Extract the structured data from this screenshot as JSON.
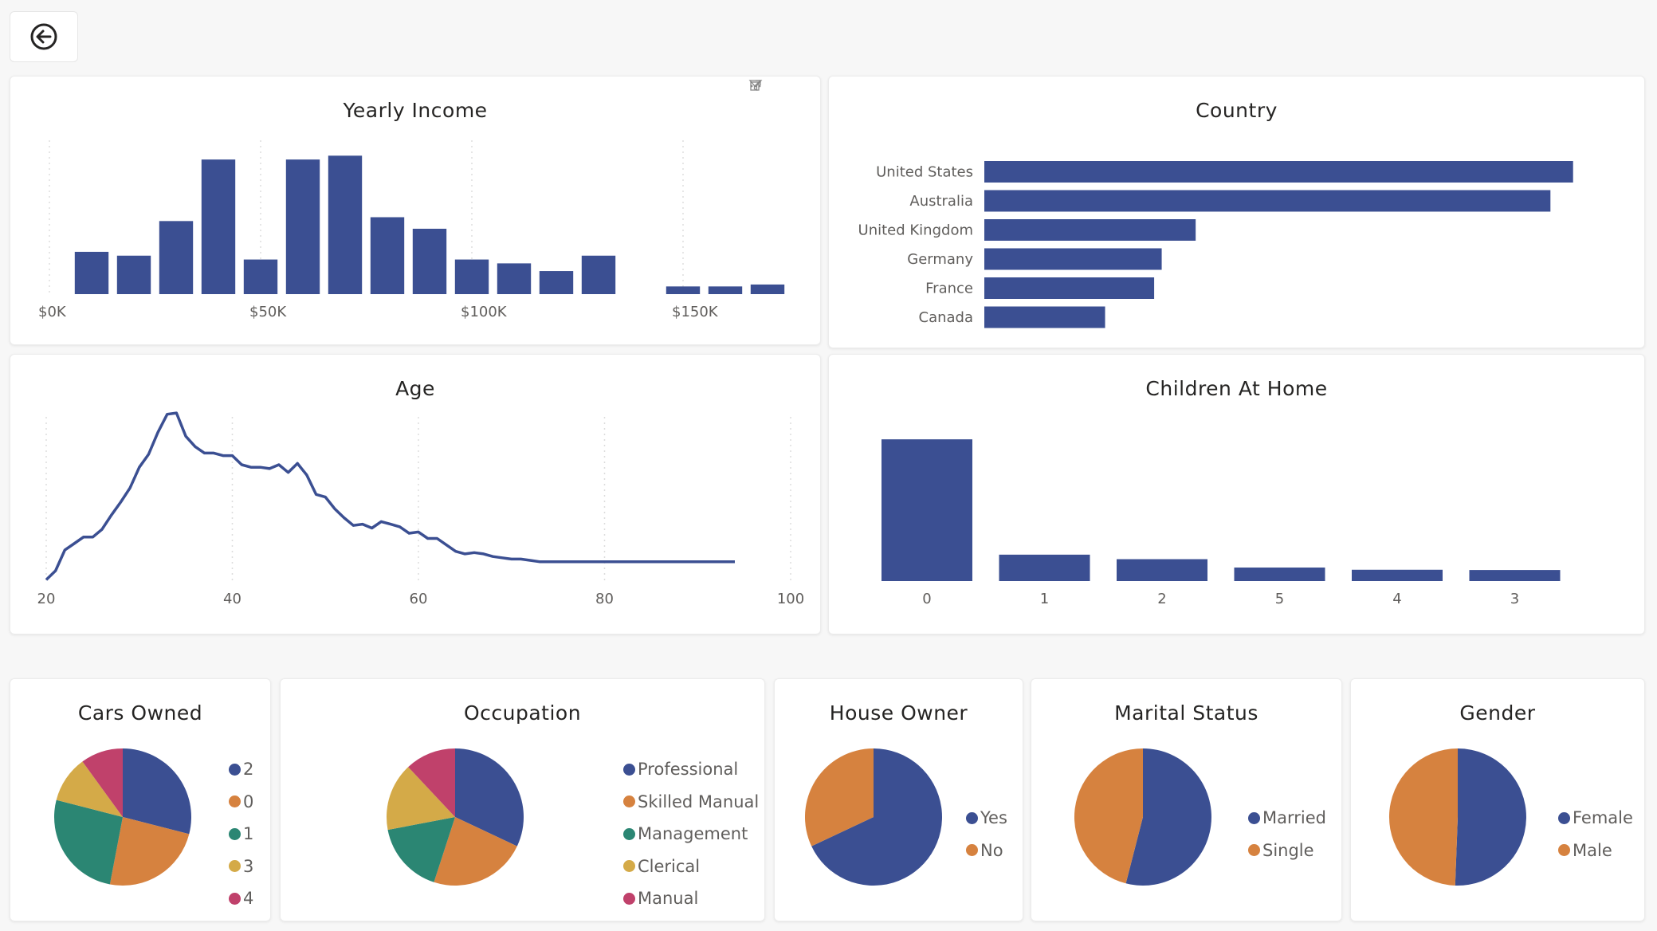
{
  "colors": {
    "blue": "#3b4f92",
    "orange": "#d6823f",
    "teal": "#2b8673",
    "yellow": "#d4aa48",
    "magenta": "#c0416b",
    "grid": "#dddddd"
  },
  "back_icon": "back-arrow-icon",
  "toolbar_icons": [
    "filter-icon",
    "focus-mode-icon",
    "more-options-icon"
  ],
  "income": {
    "title": "Yearly Income",
    "chart_data": {
      "type": "bar",
      "title": "Yearly Income",
      "x": [
        10000,
        20000,
        30000,
        40000,
        50000,
        60000,
        70000,
        80000,
        90000,
        100000,
        110000,
        120000,
        130000,
        150000,
        160000,
        170000
      ],
      "values": [
        1100,
        1000,
        1900,
        3500,
        900,
        3500,
        3600,
        2000,
        1700,
        900,
        800,
        600,
        1000,
        200,
        200,
        250
      ],
      "xlim": [
        0,
        180000
      ],
      "x_ticks": [
        0,
        50000,
        100000,
        150000
      ],
      "x_tick_labels": [
        "$0K",
        "$50K",
        "$100K",
        "$150K"
      ],
      "ylim": [
        0,
        4000
      ],
      "grid": "vertical-dotted"
    }
  },
  "country": {
    "title": "Country",
    "chart_data": {
      "type": "bar",
      "orientation": "horizontal",
      "title": "Country",
      "categories": [
        "United States",
        "Australia",
        "United Kingdom",
        "Germany",
        "France",
        "Canada"
      ],
      "values": [
        7800,
        7500,
        2800,
        2350,
        2250,
        1600
      ],
      "xlim": [
        0,
        8500
      ]
    }
  },
  "age": {
    "title": "Age",
    "chart_data": {
      "type": "line",
      "title": "Age",
      "x": [
        20,
        21,
        22,
        23,
        24,
        25,
        26,
        27,
        28,
        29,
        30,
        31,
        32,
        33,
        34,
        35,
        36,
        37,
        38,
        39,
        40,
        41,
        42,
        43,
        44,
        45,
        46,
        47,
        48,
        49,
        50,
        51,
        52,
        53,
        54,
        55,
        56,
        57,
        58,
        59,
        60,
        61,
        62,
        63,
        64,
        65,
        66,
        67,
        68,
        69,
        70,
        71,
        72,
        73,
        74,
        75,
        76,
        77,
        78,
        79,
        80,
        81,
        82,
        83,
        84,
        85,
        86,
        87,
        88,
        89,
        90,
        91,
        92,
        93,
        94
      ],
      "values": [
        10,
        80,
        240,
        290,
        340,
        340,
        400,
        510,
        610,
        720,
        880,
        980,
        1150,
        1290,
        1300,
        1120,
        1040,
        990,
        990,
        970,
        970,
        900,
        880,
        880,
        870,
        900,
        840,
        910,
        820,
        670,
        650,
        560,
        490,
        430,
        440,
        410,
        460,
        440,
        420,
        370,
        380,
        330,
        330,
        280,
        230,
        210,
        220,
        210,
        190,
        180,
        170,
        170,
        160,
        150,
        150,
        150,
        150,
        150,
        150,
        150,
        150,
        150,
        150,
        150,
        150,
        150,
        150,
        150,
        150,
        150,
        150,
        150,
        150,
        150,
        150
      ],
      "xlim": [
        20,
        100
      ],
      "x_ticks": [
        20,
        40,
        60,
        80,
        100
      ],
      "ylim": [
        0,
        1350
      ],
      "grid": "vertical-dotted"
    }
  },
  "children": {
    "title": "Children At Home",
    "chart_data": {
      "type": "bar",
      "title": "Children At Home",
      "categories": [
        "0",
        "1",
        "2",
        "5",
        "4",
        "3"
      ],
      "values": [
        11000,
        2050,
        1700,
        1050,
        880,
        860
      ],
      "ylim": [
        0,
        12000
      ]
    }
  },
  "cars": {
    "title": "Cars Owned",
    "chart_data": {
      "type": "pie",
      "title": "Cars Owned",
      "categories": [
        "2",
        "0",
        "1",
        "3",
        "4"
      ],
      "values": [
        29,
        24,
        26,
        11,
        10
      ]
    },
    "legend": [
      "2",
      "0",
      "1",
      "3",
      "4"
    ]
  },
  "occupation": {
    "title": "Occupation",
    "chart_data": {
      "type": "pie",
      "title": "Occupation",
      "categories": [
        "Professional",
        "Skilled Manual",
        "Management",
        "Clerical",
        "Manual"
      ],
      "values": [
        32,
        23,
        17,
        16,
        12
      ]
    },
    "legend": [
      "Professional",
      "Skilled Manual",
      "Management",
      "Clerical",
      "Manual"
    ]
  },
  "house": {
    "title": "House Owner",
    "chart_data": {
      "type": "pie",
      "title": "House Owner",
      "categories": [
        "Yes",
        "No"
      ],
      "values": [
        68,
        32
      ]
    },
    "legend": [
      "Yes",
      "No"
    ]
  },
  "marital": {
    "title": "Marital Status",
    "chart_data": {
      "type": "pie",
      "title": "Marital Status",
      "categories": [
        "Married",
        "Single"
      ],
      "values": [
        54,
        46
      ]
    },
    "legend": [
      "Married",
      "Single"
    ]
  },
  "gender": {
    "title": "Gender",
    "chart_data": {
      "type": "pie",
      "title": "Gender",
      "categories": [
        "Female",
        "Male"
      ],
      "values": [
        50.6,
        49.4
      ]
    },
    "legend": [
      "Female",
      "Male"
    ]
  }
}
